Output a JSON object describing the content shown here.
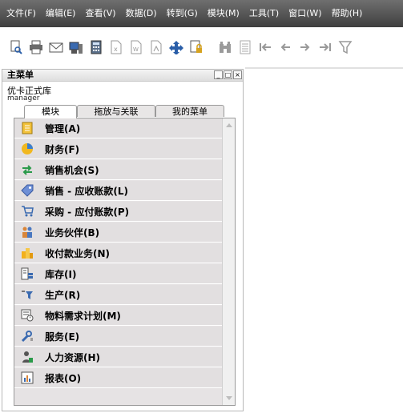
{
  "menubar": {
    "items": [
      {
        "label": "文件(F)"
      },
      {
        "label": "编辑(E)"
      },
      {
        "label": "查看(V)"
      },
      {
        "label": "数据(D)"
      },
      {
        "label": "转到(G)"
      },
      {
        "label": "模块(M)"
      },
      {
        "label": "工具(T)"
      },
      {
        "label": "窗口(W)"
      },
      {
        "label": "帮助(H)"
      }
    ]
  },
  "toolbar": {
    "icons": [
      "print-preview-icon",
      "print-icon",
      "email-icon",
      "fax-icon",
      "calculator-icon",
      "export-excel-icon",
      "export-word-icon",
      "export-pdf-icon",
      "launch-app-icon",
      "lock-icon",
      "binoculars-icon",
      "list-icon",
      "first-record-icon",
      "previous-record-icon",
      "next-record-icon",
      "last-record-icon",
      "filter-icon"
    ]
  },
  "main_menu_window": {
    "title": "主菜单",
    "company": "优卡正式库",
    "user": "manager",
    "controls": [
      "_",
      "□",
      "×"
    ],
    "tabs": [
      {
        "label": "模块",
        "active": true
      },
      {
        "label": "拖放与关联",
        "active": false
      },
      {
        "label": "我的菜单",
        "active": false
      }
    ],
    "modules": [
      {
        "label": "管理(A)",
        "icon": "administration-icon"
      },
      {
        "label": "财务(F)",
        "icon": "financials-icon"
      },
      {
        "label": "销售机会(S)",
        "icon": "opportunities-icon"
      },
      {
        "label": "销售 - 应收账款(L)",
        "icon": "sales-ar-icon"
      },
      {
        "label": "采购 - 应付账款(P)",
        "icon": "purchasing-ap-icon"
      },
      {
        "label": "业务伙伴(B)",
        "icon": "business-partners-icon"
      },
      {
        "label": "收付款业务(N)",
        "icon": "banking-icon"
      },
      {
        "label": "库存(I)",
        "icon": "inventory-icon"
      },
      {
        "label": "生产(R)",
        "icon": "production-icon"
      },
      {
        "label": "物料需求计划(M)",
        "icon": "mrp-icon"
      },
      {
        "label": "服务(E)",
        "icon": "service-icon"
      },
      {
        "label": "人力资源(H)",
        "icon": "human-resources-icon"
      },
      {
        "label": "报表(O)",
        "icon": "reports-icon"
      }
    ]
  }
}
